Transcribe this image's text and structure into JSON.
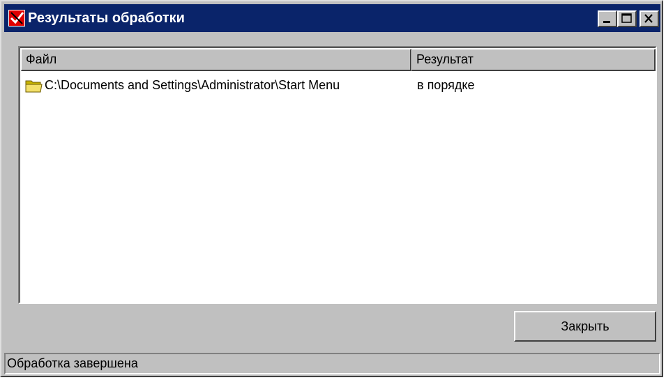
{
  "window": {
    "title": "Результаты обработки",
    "icon": "red-check-app-icon",
    "controls": [
      "minimize-icon",
      "maximize-icon",
      "close-icon"
    ]
  },
  "list": {
    "columns": [
      "Файл",
      "Результат"
    ],
    "rows": [
      {
        "icon": "folder-icon",
        "file": "C:\\Documents and Settings\\Administrator\\Start Menu",
        "result": "в порядке"
      }
    ]
  },
  "buttons": {
    "close_label": "Закрыть"
  },
  "status": {
    "text": "Обработка завершена"
  },
  "colors": {
    "titlebar": "#0a246a",
    "face": "#c0c0c0",
    "list_bg": "#ffffff"
  }
}
